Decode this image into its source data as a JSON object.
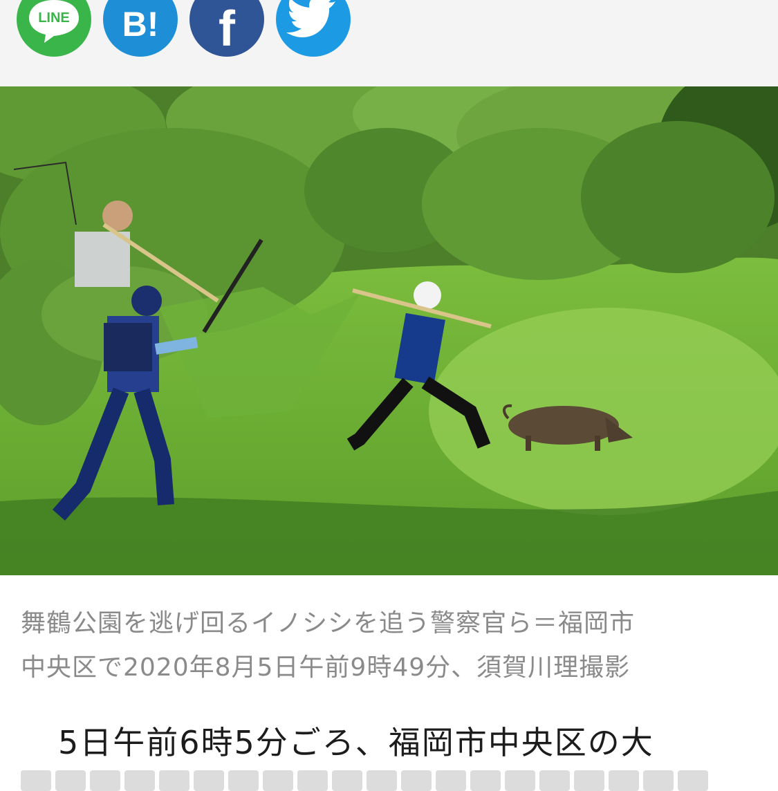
{
  "share": {
    "buttons": [
      {
        "name": "line",
        "label": "LINE",
        "color": "#3ab54a"
      },
      {
        "name": "hatena",
        "label": "B!",
        "color": "#1e8fd6"
      },
      {
        "name": "facebook",
        "label": "f",
        "color": "#2f5597"
      },
      {
        "name": "twitter",
        "label": "",
        "color": "#1d9ae4"
      }
    ]
  },
  "photo": {
    "caption_line1": "舞鶴公園を逃げ回るイノシシを追う警察官ら＝福岡市",
    "caption_line2": "中央区で2020年8月5日午前9時49分、須賀川理撮影"
  },
  "article": {
    "first_line": "5日午前6時5分ごろ、福岡市中央区の大"
  }
}
